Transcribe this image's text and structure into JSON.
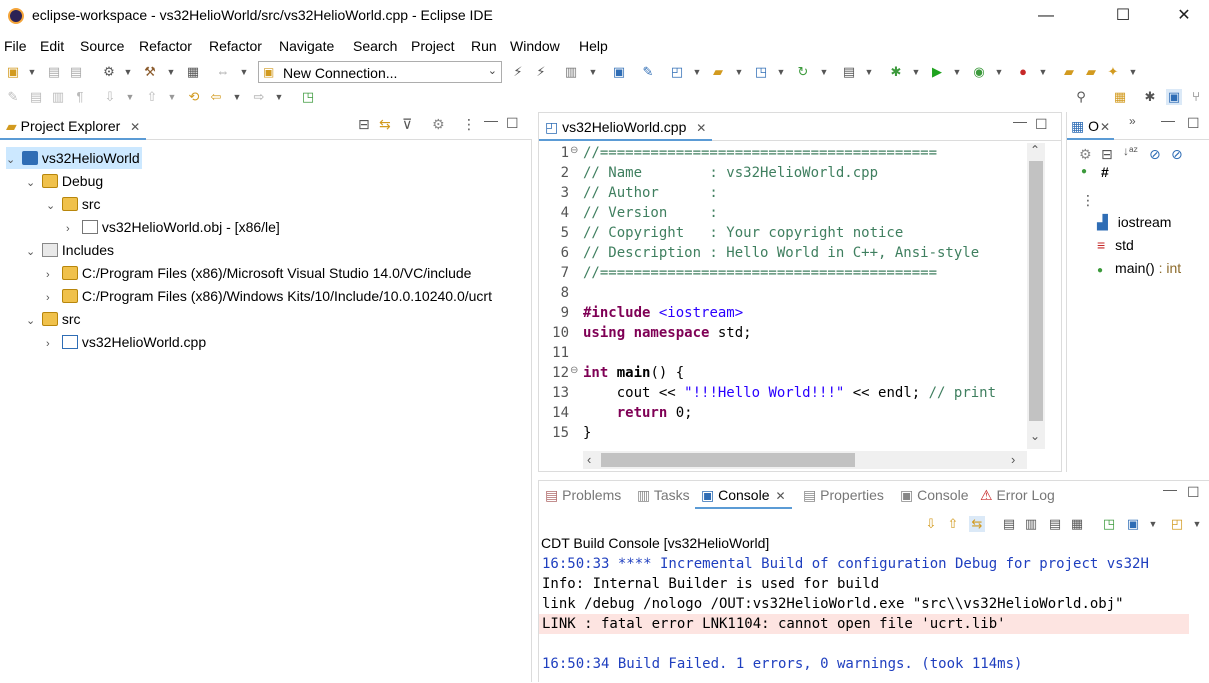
{
  "window": {
    "title": "eclipse-workspace - vs32HelioWorld/src/vs32HelioWorld.cpp - Eclipse IDE",
    "minimize": "—",
    "maximize": "☐",
    "close": "✕"
  },
  "menu": [
    "File",
    "Edit",
    "Source",
    "Refactor",
    "Refactor",
    "Navigate",
    "Search",
    "Project",
    "Run",
    "Window",
    "Help"
  ],
  "toolbar": {
    "connection_value": "New Connection..."
  },
  "project_explorer": {
    "tab_label": "Project Explorer",
    "tree": [
      {
        "label": "vs32HelioWorld",
        "chev": "⌄"
      },
      {
        "label": "Debug",
        "chev": "⌄"
      },
      {
        "label": "src",
        "chev": "⌄"
      },
      {
        "label": "vs32HelioWorld.obj - [x86/le]",
        "chev": "›"
      },
      {
        "label": "Includes",
        "chev": "⌄"
      },
      {
        "label": "C:/Program Files (x86)/Microsoft Visual Studio 14.0/VC/include",
        "chev": "›"
      },
      {
        "label": "C:/Program Files (x86)/Windows Kits/10/Include/10.0.10240.0/ucrt",
        "chev": "›"
      },
      {
        "label": "src",
        "chev": "⌄"
      },
      {
        "label": "vs32HelioWorld.cpp",
        "chev": "›"
      }
    ]
  },
  "editor": {
    "tab_label": "vs32HelioWorld.cpp",
    "line_numbers": [
      "1",
      "2",
      "3",
      "4",
      "5",
      "6",
      "7",
      "8",
      "9",
      "10",
      "11",
      "12",
      "13",
      "14",
      "15"
    ],
    "lines": {
      "l1": "//========================================",
      "l2": "// Name        : vs32HelioWorld.cpp",
      "l3": "// Author      :",
      "l4": "// Version     :",
      "l5": "// Copyright   : Your copyright notice",
      "l6": "// Description : Hello World in C++, Ansi-style",
      "l7": "//========================================",
      "l9a": "#include",
      "l9b": " <iostream>",
      "l10a": "using namespace",
      "l10b": " std;",
      "l12a": "int",
      "l12b": " main",
      "l12c": "() {",
      "l13a": "    cout << ",
      "l13b": "\"!!!Hello World!!!\"",
      "l13c": " << endl; ",
      "l13d": "// print",
      "l14a": "    ",
      "l14b": "return",
      "l14c": " 0;",
      "l15": "}"
    }
  },
  "outline": {
    "tab_label": "O",
    "items": [
      {
        "label": "iostream",
        "suffix": ""
      },
      {
        "label": "std",
        "suffix": ""
      },
      {
        "label": "main()",
        "suffix": " : int"
      }
    ]
  },
  "bottom_tabs": [
    {
      "label": "Problems"
    },
    {
      "label": "Tasks"
    },
    {
      "label": "Console"
    },
    {
      "label": "Properties"
    },
    {
      "label": "Console"
    },
    {
      "label": "Error Log"
    }
  ],
  "console": {
    "title": "CDT Build Console [vs32HelioWorld]",
    "lines": [
      {
        "text": "16:50:33 **** Incremental Build of configuration Debug for project vs32H",
        "kind": "info"
      },
      {
        "text": "Info: Internal Builder is used for build",
        "kind": "plain"
      },
      {
        "text": "link /debug /nologo /OUT:vs32HelioWorld.exe \"src\\\\vs32HelioWorld.obj\"",
        "kind": "plain"
      },
      {
        "text": "LINK : fatal error LNK1104: cannot open file 'ucrt.lib'",
        "kind": "error"
      },
      {
        "text": "",
        "kind": "plain"
      },
      {
        "text": "16:50:34 Build Failed. 1 errors, 0 warnings. (took 114ms)",
        "kind": "info"
      }
    ]
  },
  "colors": {
    "accent": "#5b9bd5",
    "error_bg": "#fde4e1",
    "info_text": "#1f3fbf",
    "selection": "#cce8ff"
  }
}
